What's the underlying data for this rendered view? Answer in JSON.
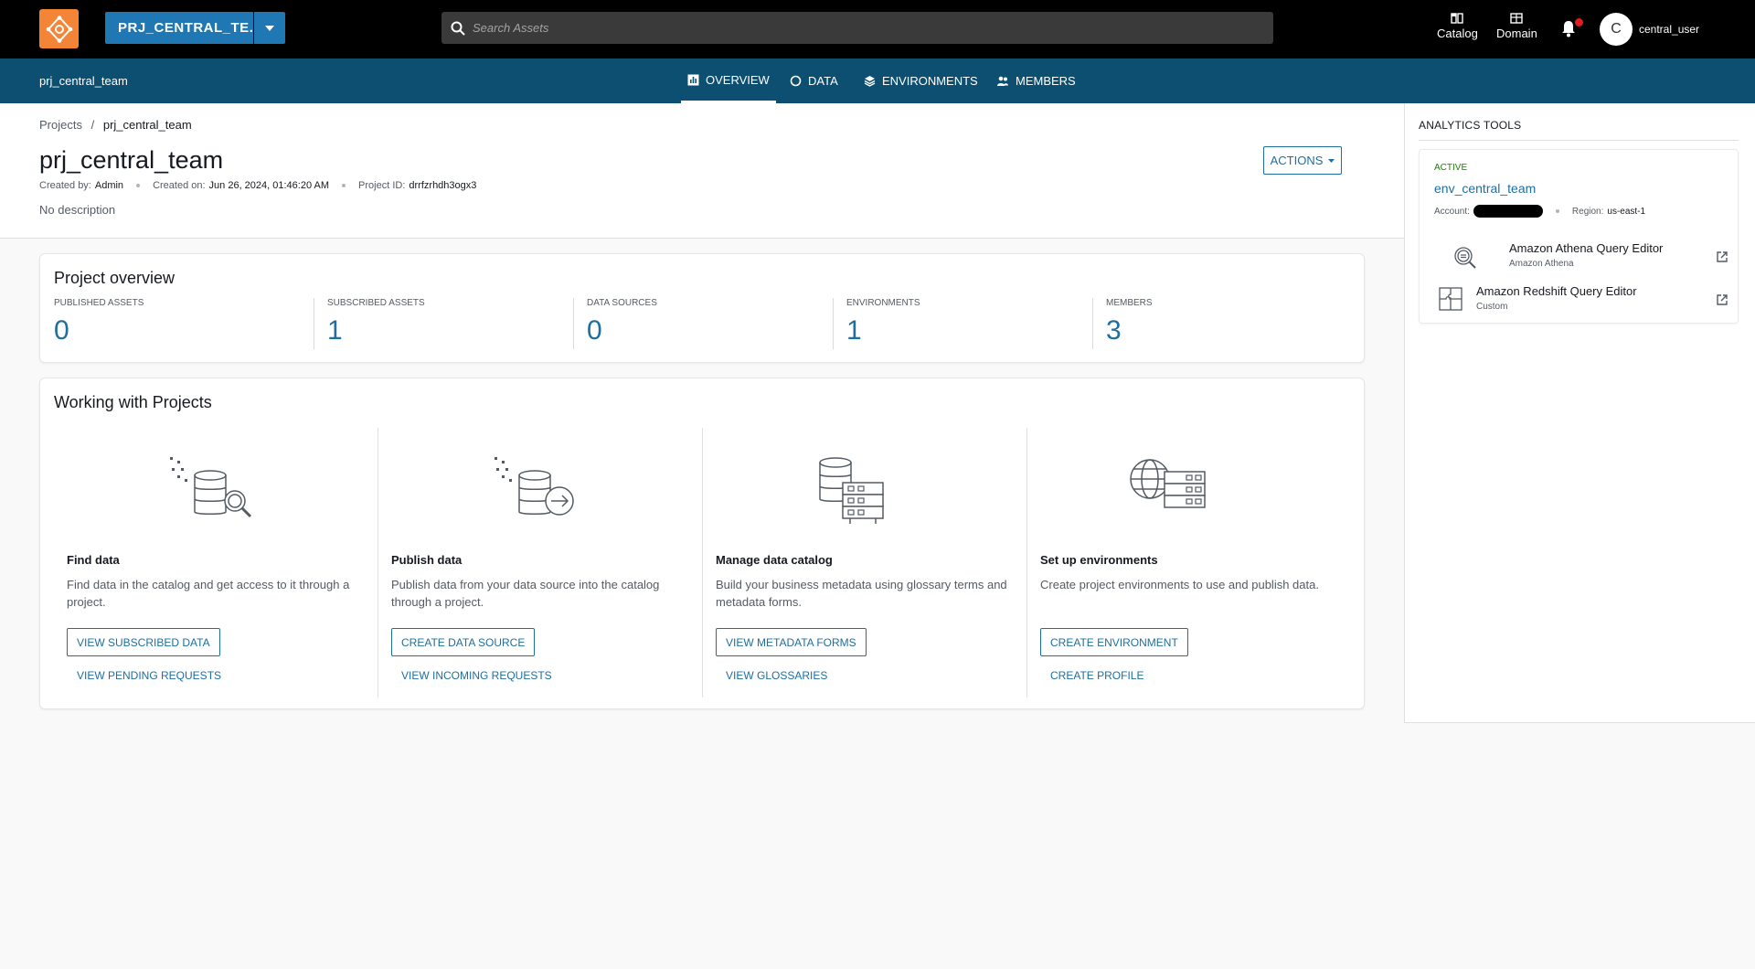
{
  "topbar": {
    "project_button": "PRJ_CENTRAL_TE...",
    "search_placeholder": "Search Assets",
    "catalog_label": "Catalog",
    "domain_label": "Domain",
    "avatar_initial": "C",
    "username": "central_user"
  },
  "subnav": {
    "project_name": "prj_central_team",
    "tabs": [
      {
        "label": "OVERVIEW",
        "active": true
      },
      {
        "label": "DATA",
        "active": false
      },
      {
        "label": "ENVIRONMENTS",
        "active": false
      },
      {
        "label": "MEMBERS",
        "active": false
      }
    ]
  },
  "header": {
    "breadcrumb_root": "Projects",
    "breadcrumb_sep": "/",
    "breadcrumb_current": "prj_central_team",
    "title": "prj_central_team",
    "created_by_label": "Created by:",
    "created_by": "Admin",
    "created_on_label": "Created on:",
    "created_on": "Jun 26, 2024, 01:46:20 AM",
    "project_id_label": "Project ID:",
    "project_id": "drrfzrhdh3ogx3",
    "description": "No description",
    "actions_label": "ACTIONS"
  },
  "overview": {
    "title": "Project overview",
    "stats": [
      {
        "label": "PUBLISHED ASSETS",
        "value": "0"
      },
      {
        "label": "SUBSCRIBED ASSETS",
        "value": "1"
      },
      {
        "label": "DATA SOURCES",
        "value": "0"
      },
      {
        "label": "ENVIRONMENTS",
        "value": "1"
      },
      {
        "label": "MEMBERS",
        "value": "3"
      }
    ]
  },
  "working": {
    "title": "Working with Projects",
    "columns": [
      {
        "title": "Find data",
        "desc": "Find data in the catalog and get access to it through a project.",
        "primary": "VIEW SUBSCRIBED DATA",
        "secondary": "VIEW PENDING REQUESTS",
        "icon": "database-search-icon"
      },
      {
        "title": "Publish data",
        "desc": "Publish data from your data source into the catalog through a project.",
        "primary": "CREATE DATA SOURCE",
        "secondary": "VIEW INCOMING REQUESTS",
        "icon": "database-publish-icon"
      },
      {
        "title": "Manage data catalog",
        "desc": "Build your business metadata using glossary terms and metadata forms.",
        "primary": "VIEW METADATA FORMS",
        "secondary": "VIEW GLOSSARIES",
        "icon": "database-servers-icon"
      },
      {
        "title": "Set up environments",
        "desc": "Create project environments to use and publish data.",
        "primary": "CREATE ENVIRONMENT",
        "secondary": "CREATE PROFILE",
        "icon": "globe-servers-icon"
      }
    ]
  },
  "analytics": {
    "title": "ANALYTICS TOOLS",
    "status": "ACTIVE",
    "env_name": "env_central_team",
    "account_label": "Account:",
    "region_label": "Region:",
    "region": "us-east-1",
    "tools": [
      {
        "name": "Amazon Athena Query Editor",
        "sub": "Amazon Athena"
      },
      {
        "name": "Amazon Redshift Query Editor",
        "sub": "Custom"
      }
    ]
  },
  "colors": {
    "accent": "#1d6fa0",
    "subnav_bg": "#0d4f70",
    "project_button_bg": "#1f78b4",
    "logo_bg": "#f58536",
    "active_green": "#1d8102"
  }
}
